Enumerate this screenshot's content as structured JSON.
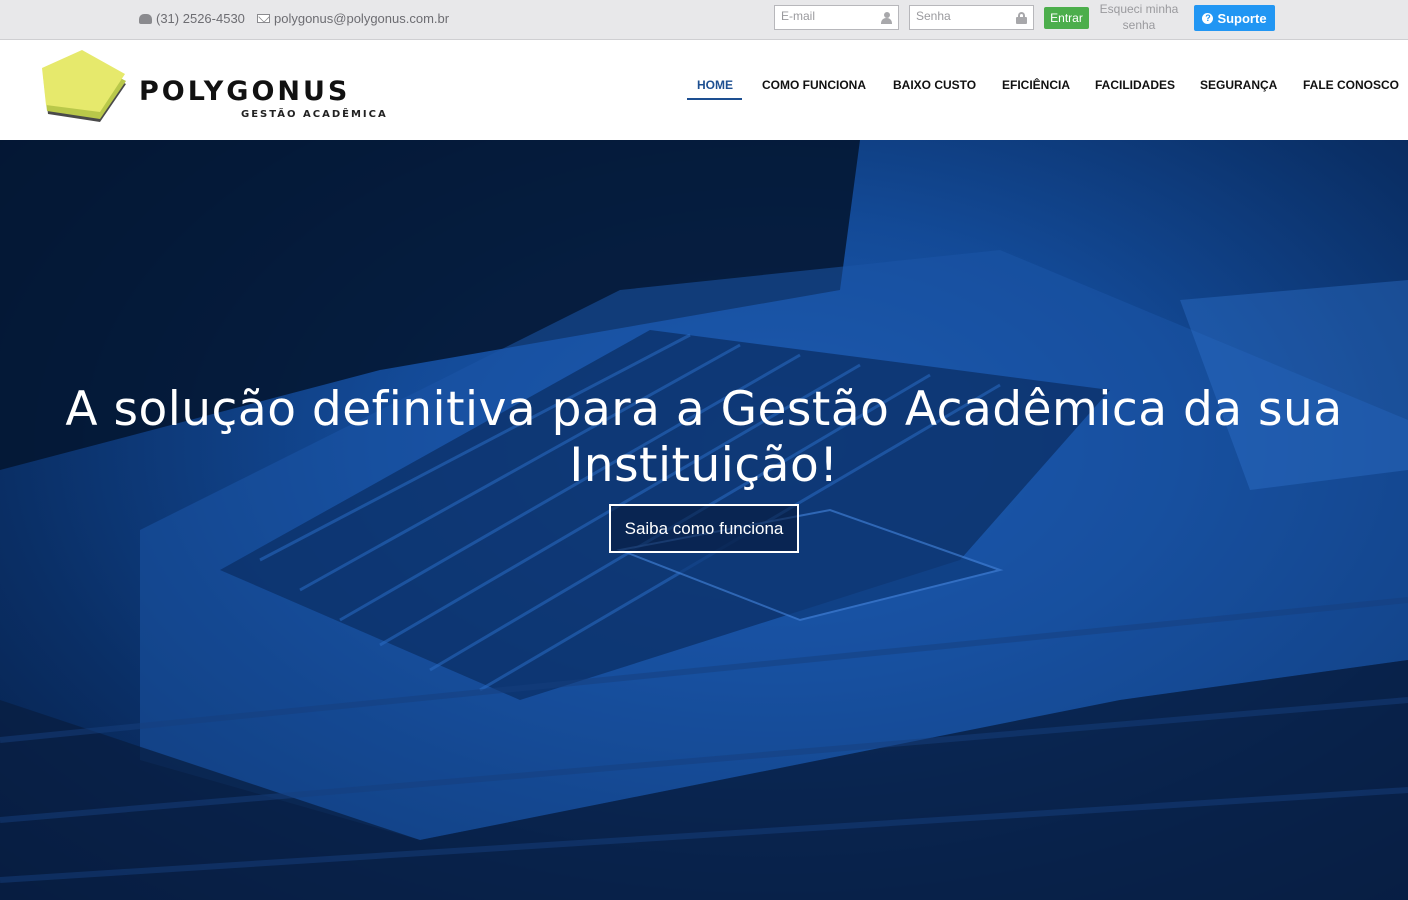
{
  "topbar": {
    "phone": "(31) 2526-4530",
    "email": "polygonus@polygonus.com.br",
    "login": {
      "email_placeholder": "E-mail",
      "password_placeholder": "Senha",
      "submit_label": "Entrar",
      "forgot_label": "Esqueci minha senha",
      "support_label": "Suporte"
    }
  },
  "brand": {
    "name": "POLYGONUS",
    "tagline": "GESTÃO ACADÊMICA",
    "colors": {
      "logo_yellow": "#e6e96c",
      "logo_green": "#b9c84a"
    }
  },
  "nav": {
    "items": [
      {
        "label": "HOME",
        "active": true
      },
      {
        "label": "COMO FUNCIONA"
      },
      {
        "label": "BAIXO CUSTO"
      },
      {
        "label": "EFICIÊNCIA"
      },
      {
        "label": "FACILIDADES"
      },
      {
        "label": "SEGURANÇA"
      },
      {
        "label": "FALE CONOSCO"
      }
    ],
    "accent": "#1d4f91"
  },
  "hero": {
    "title": "A solução definitiva para a Gestão Acadêmica da sua Instituição!",
    "cta_label": "Saiba como funciona",
    "overlay_color": "#134a97"
  },
  "icons": [
    "phone-icon",
    "mail-icon",
    "user-icon",
    "lock-icon",
    "help-icon"
  ]
}
